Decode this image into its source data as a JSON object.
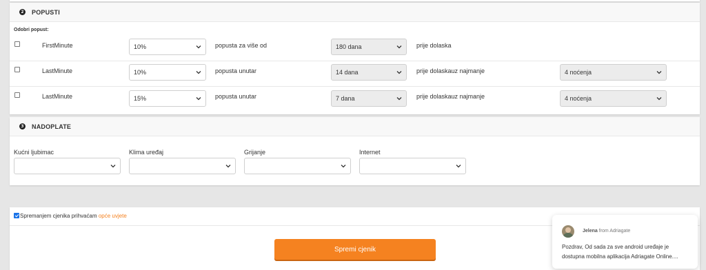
{
  "popusti": {
    "number": "2",
    "title": "POPUSTI",
    "approve_label": "Odobri popust:",
    "rows": [
      {
        "name": "FirstMinute",
        "discount": "10%",
        "text1": "popusta za više od",
        "days": "180 dana",
        "text2": "prije dolaska",
        "nights": ""
      },
      {
        "name": "LastMinute",
        "discount": "10%",
        "text1": "popusta unutar",
        "days": "14 dana",
        "text2": "prije dolaskauz najmanje",
        "nights": "4 noćenja"
      },
      {
        "name": "LastMinute",
        "discount": "15%",
        "text1": "popusta unutar",
        "days": "7 dana",
        "text2": "prije dolaskauz najmanje",
        "nights": "4 noćenja"
      }
    ]
  },
  "nadoplate": {
    "number": "3",
    "title": "NADOPLATE",
    "fields": [
      {
        "label": "Kućni ljubimac",
        "value": ""
      },
      {
        "label": "Klima uređaj",
        "value": ""
      },
      {
        "label": "Grijanje",
        "value": ""
      },
      {
        "label": "Internet",
        "value": ""
      }
    ]
  },
  "terms": {
    "text": "Spremanjem cjenika prihvaćam",
    "link": "opće uvjete",
    "checked": true
  },
  "save_button": "Spremi cjenik",
  "chat": {
    "agent": "Jelena",
    "from": "from Adriagate",
    "message": "Pozdrav, Od sada za sve android uređaje je dostupna mobilna aplikacija Adriagate Online...."
  },
  "colors": {
    "accent": "#f58220",
    "link": "#f58220"
  }
}
